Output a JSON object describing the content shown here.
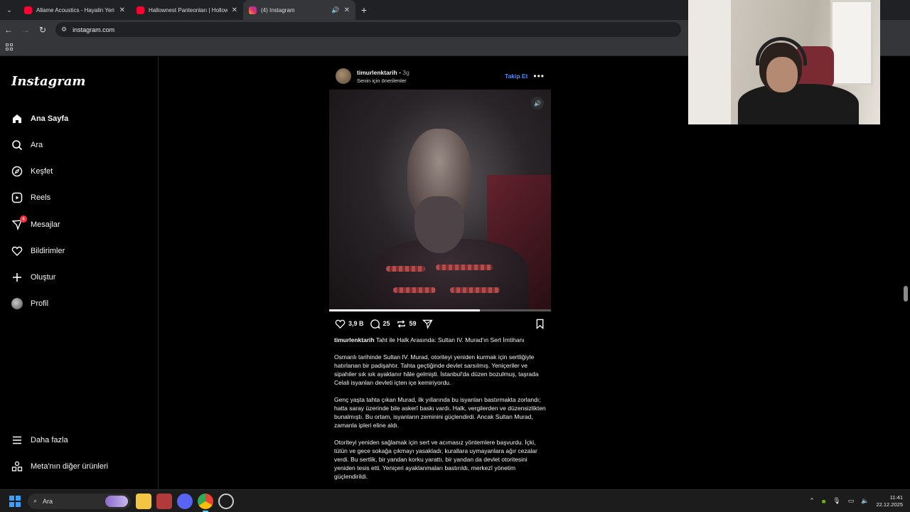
{
  "browser": {
    "tabs": [
      {
        "label": "Allame Acoustics - Hayalin Yeri",
        "icon": "youtube-icon",
        "color": "#ff0033"
      },
      {
        "label": "Hallownest Panteonları | Hollow",
        "icon": "youtube-icon",
        "color": "#ff0033"
      },
      {
        "label": "(4) Instagram",
        "icon": "instagram-icon",
        "color": "#e1306c",
        "active": true
      }
    ],
    "url": "instagram.com"
  },
  "sidebar": {
    "logo": "Instagram",
    "items": [
      {
        "label": "Ana Sayfa",
        "icon": "home-icon"
      },
      {
        "label": "Ara",
        "icon": "search-icon"
      },
      {
        "label": "Keşfet",
        "icon": "compass-icon"
      },
      {
        "label": "Reels",
        "icon": "reels-icon"
      },
      {
        "label": "Mesajlar",
        "icon": "messenger-icon",
        "badge": "4"
      },
      {
        "label": "Bildirimler",
        "icon": "heart-icon"
      },
      {
        "label": "Oluştur",
        "icon": "plus-icon"
      },
      {
        "label": "Profil",
        "icon": "profile-avatar-icon"
      }
    ],
    "bottom": [
      {
        "label": "Daha fazla",
        "icon": "menu-icon"
      },
      {
        "label": "Meta'nın diğer ürünleri",
        "icon": "meta-products-icon"
      }
    ]
  },
  "post": {
    "username": "timurlenktarih",
    "time": "3g",
    "subtitle": "Senin için önerilenler",
    "follow_label": "Takip Et",
    "progress": 0.68,
    "likes": "3,9 B",
    "comments": "25",
    "reposts": "59",
    "caption_title": "Taht ile Halk Arasında: Sultan IV. Murad'ın Sert İmtihanı",
    "paragraphs": [
      "Osmanlı tarihinde Sultan IV. Murad, otoriteyi yeniden kurmak için sertliğiyle hatırlanan bir padişahtır. Tahta geçtiğinde devlet sarsılmış. Yeniçeriler ve sipahiler sık sık ayaklanır hâle gelmişti. İstanbul'da düzen bozulmuş, taşrada Celali isyanları devleti içten içe kemiriyordu.",
      "Genç yaşta tahta çıkan Murad, ilk yıllarında bu isyanları bastırmakta zorlandı; hatta saray üzerinde bile askerî baskı vardı. Halk, vergilerden ve düzensizlikten bunalmıştı. Bu ortam, isyanların zeminini güçlendirdi. Ancak Sultan Murad, zamanla ipleri eline aldı.",
      "Otoriteyi yeniden sağlamak için sert ve acımasız yöntemlere başvurdu. İçki, tütün ve gece sokağa çıkmayı yasakladı; kurallara uymayanlara ağır cezalar verdi. Bu sertlik, bir yandan korku yarattı, bir yandan da devlet otoritesini yeniden tesis etti. Yeniçeri ayaklanmaları bastırıldı, merkezî yönetim güçlendirildi."
    ]
  },
  "taskbar": {
    "search_label": "Ara",
    "time": "11:41",
    "date": "22.12.2025"
  }
}
